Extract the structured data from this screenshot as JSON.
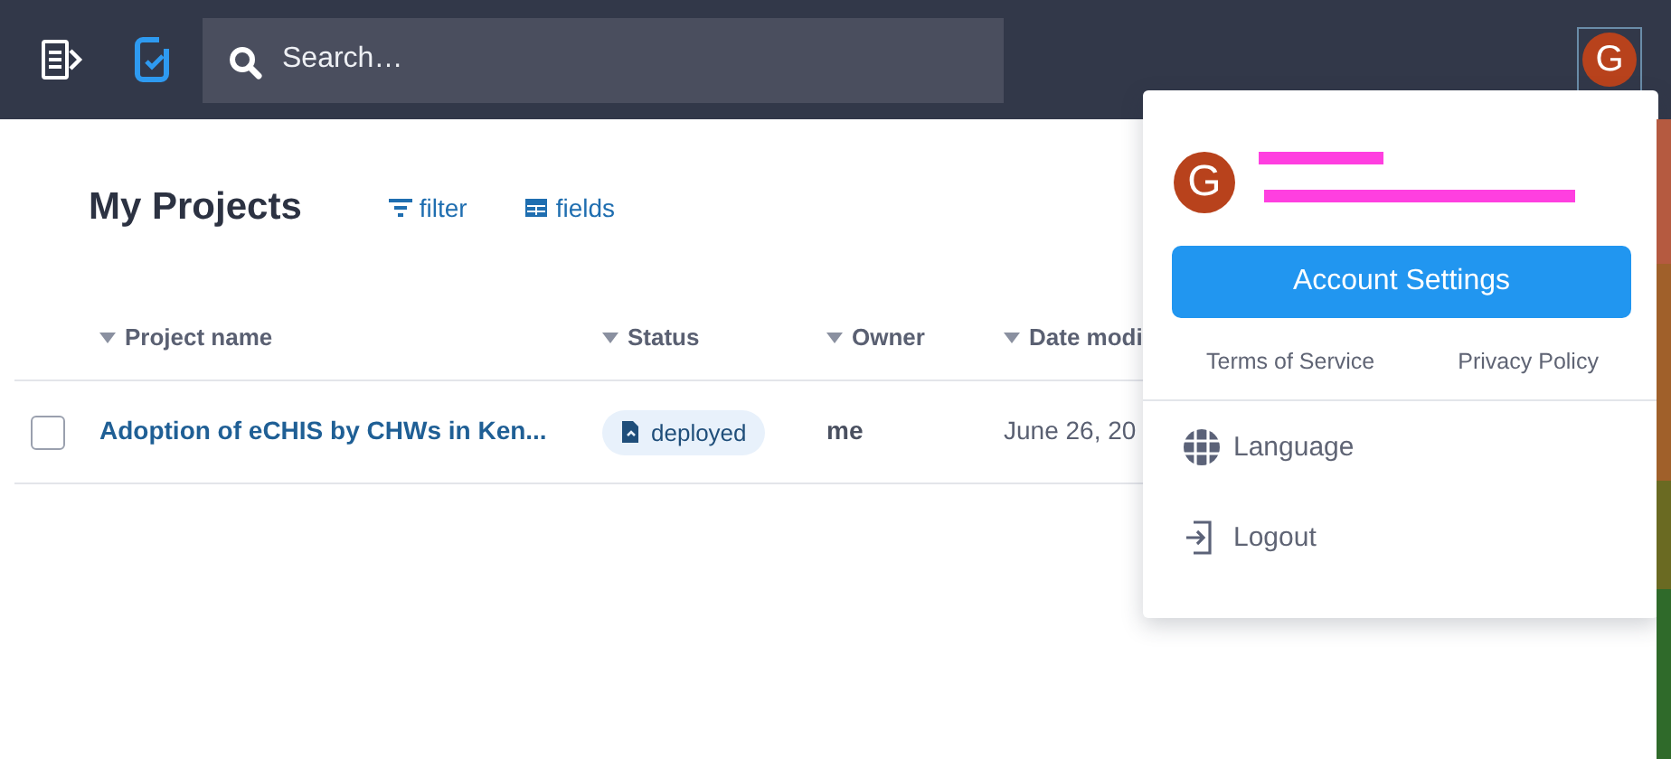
{
  "topbar": {
    "search": {
      "placeholder": "Search…"
    },
    "avatar_letter": "G"
  },
  "page": {
    "title": "My Projects",
    "actions": [
      {
        "kind": "filter",
        "label": "filter"
      },
      {
        "kind": "fields",
        "label": "fields"
      }
    ]
  },
  "table": {
    "columns": [
      "Project name",
      "Status",
      "Owner",
      "Date modi"
    ],
    "rows": [
      {
        "checked": false,
        "name": "Adoption of eCHIS by CHWs in Ken...",
        "status": "deployed",
        "owner": "me",
        "date": "June 26, 20"
      }
    ]
  },
  "account_menu": {
    "avatar_letter": "G",
    "button": "Account Settings",
    "links": [
      "Terms of Service",
      "Privacy Policy"
    ],
    "items": [
      {
        "kind": "language",
        "label": "Language"
      },
      {
        "kind": "logout",
        "label": "Logout"
      }
    ]
  }
}
